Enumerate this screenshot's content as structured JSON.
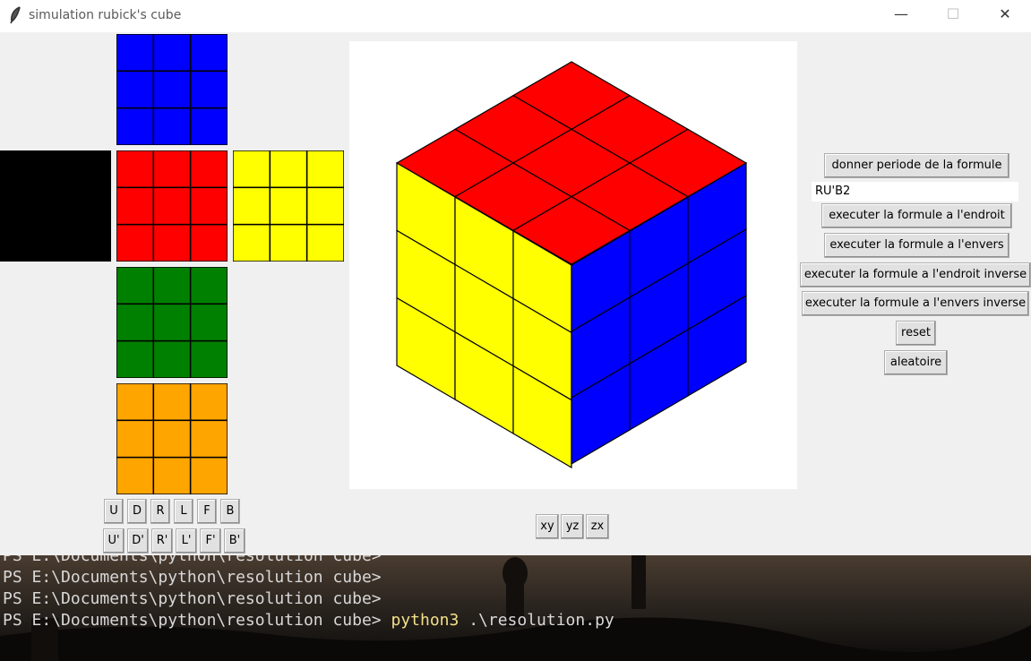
{
  "window": {
    "title": "simulation rubick's cube",
    "minimize_glyph": "—",
    "maximize_glyph": "☐",
    "close_glyph": "✕",
    "icon": "feather-icon"
  },
  "colors": {
    "U": "#0000ff",
    "L": "#000000",
    "F": "#ff0000",
    "R": "#ffff00",
    "D": "#008000",
    "B": "#ffa500",
    "iso_top": "#ff0000",
    "iso_left": "#ffff00",
    "iso_right": "#0000ff"
  },
  "net_faces": [
    "U",
    "L",
    "F",
    "R",
    "D",
    "B"
  ],
  "controls": {
    "period_button": "donner periode de la formule",
    "formula_value": "RU'B2",
    "exec_forward": "executer la formule a l'endroit",
    "exec_backward": "executer la formule a l'envers",
    "exec_forward_inverse": "executer la formule a l'endroit inverse",
    "exec_backward_inverse": "executer la formule a l'envers inverse",
    "reset": "reset",
    "random": "aleatoire"
  },
  "moves": {
    "row1": [
      "U",
      "D",
      "R",
      "L",
      "F",
      "B"
    ],
    "row2": [
      "U'",
      "D'",
      "R'",
      "L'",
      "F'",
      "B'"
    ]
  },
  "view_buttons": [
    "xy",
    "yz",
    "zx"
  ],
  "terminal": {
    "prompt": "PS E:\\Documents\\python\\resolution cube>",
    "command_exe": "python3",
    "command_arg": ".\\resolution.py"
  }
}
